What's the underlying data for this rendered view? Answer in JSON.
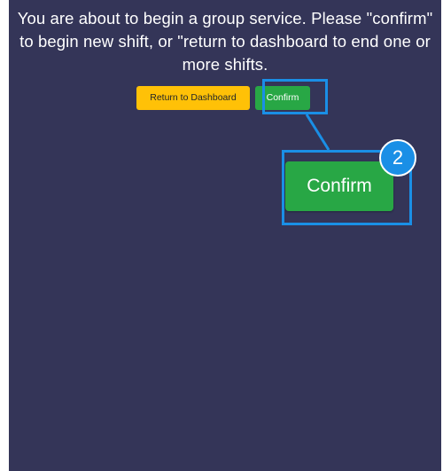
{
  "dialog": {
    "message": "You are about to begin a group service. Please \"confirm\" to begin new shift, or \"return to dashboard to end one or more shifts.",
    "return_label": "Return to Dashboard",
    "confirm_label": "Confirm"
  },
  "annotation": {
    "zoom_label": "Confirm",
    "step_number": "2",
    "color": "#1a8fe6"
  },
  "colors": {
    "panel_background": "#343558",
    "return_button": "#ffc107",
    "confirm_button": "#28a745"
  }
}
